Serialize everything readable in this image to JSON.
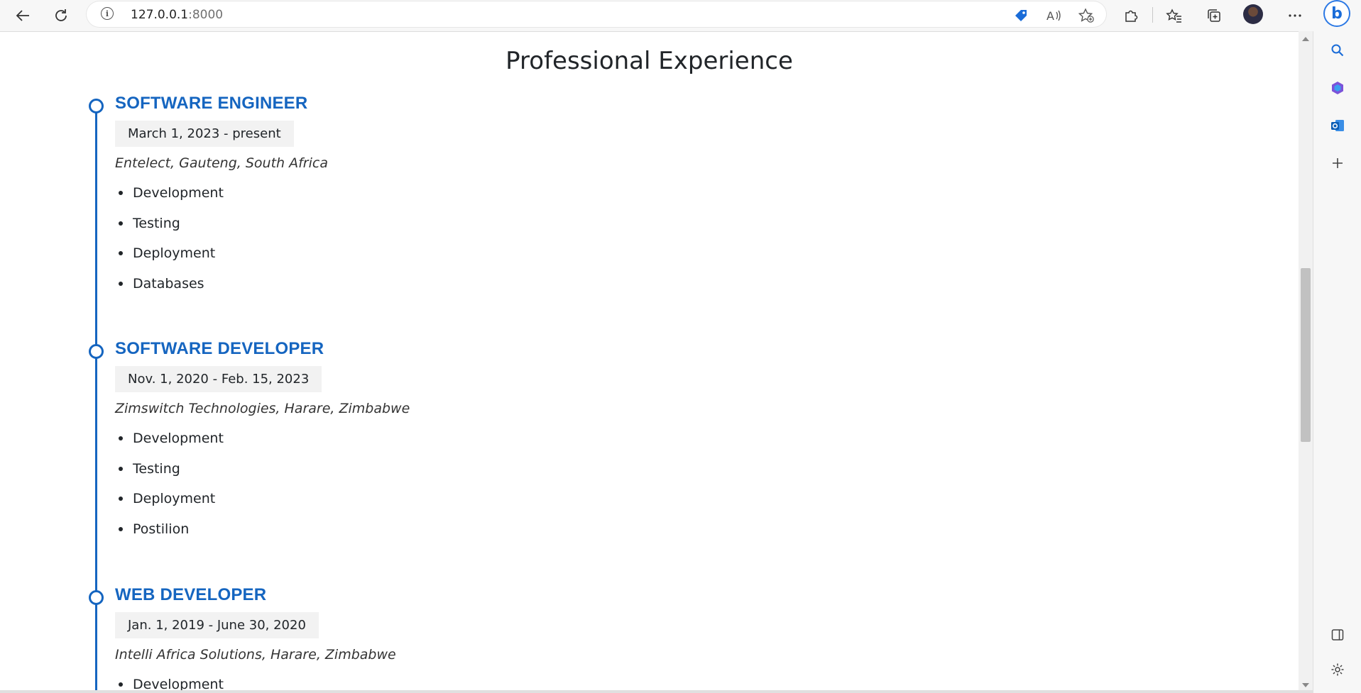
{
  "browser": {
    "url_host": "127.0.0.1",
    "url_port": ":8000"
  },
  "page": {
    "title": "Professional Experience",
    "jobs": [
      {
        "title": "SOFTWARE ENGINEER",
        "dates": "March 1, 2023 - present",
        "company": "Entelect, Gauteng, South Africa",
        "duties": [
          "Development",
          "Testing",
          "Deployment",
          "Databases"
        ]
      },
      {
        "title": "SOFTWARE DEVELOPER",
        "dates": "Nov. 1, 2020 - Feb. 15, 2023",
        "company": "Zimswitch Technologies, Harare, Zimbabwe",
        "duties": [
          "Development",
          "Testing",
          "Deployment",
          "Postilion"
        ]
      },
      {
        "title": "WEB DEVELOPER",
        "dates": "Jan. 1, 2019 - June 30, 2020",
        "company": "Intelli Africa Solutions, Harare, Zimbabwe",
        "duties": [
          "Development"
        ]
      }
    ]
  },
  "colors": {
    "accent": "#1565c0",
    "date_badge_bg": "#f2f2f2",
    "text": "#212529"
  }
}
